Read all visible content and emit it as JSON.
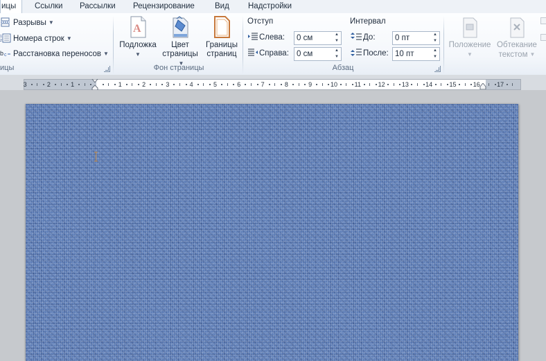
{
  "tabs": [
    {
      "label": "ицы",
      "active": true
    },
    {
      "label": "Ссылки"
    },
    {
      "label": "Рассылки"
    },
    {
      "label": "Рецензирование"
    },
    {
      "label": "Вид"
    },
    {
      "label": "Надстройки"
    }
  ],
  "page_setup": {
    "breaks_label": "Разрывы",
    "line_numbers_label": "Номера строк",
    "hyphenation_label": "Расстановка переносов",
    "group_label": "ицы"
  },
  "page_background": {
    "watermark_label_1": "Подложка",
    "page_color_label_1": "Цвет",
    "page_color_label_2": "страницы",
    "page_borders_label_1": "Границы",
    "page_borders_label_2": "страниц",
    "group_label": "Фон страницы"
  },
  "paragraph": {
    "indent_title": "Отступ",
    "indent_left_label": "Слева:",
    "indent_left_value": "0 см",
    "indent_right_label": "Справа:",
    "indent_right_value": "0 см",
    "spacing_title": "Интервал",
    "spacing_before_label": "До:",
    "spacing_before_value": "0 пт",
    "spacing_after_label": "После:",
    "spacing_after_value": "10 пт",
    "group_label": "Абзац"
  },
  "arrange": {
    "position_label": "Положение",
    "wrap_text_label_1": "Обтекание",
    "wrap_text_label_2": "текстом"
  },
  "ruler": {
    "labels": [
      "3",
      "2",
      "1",
      "1",
      "2",
      "3",
      "4",
      "5",
      "6",
      "7",
      "8",
      "9",
      "10",
      "11",
      "12",
      "13",
      "14",
      "15",
      "16",
      "17"
    ]
  },
  "colors": {
    "page_texture": "#5f7fb8",
    "ribbon_border": "#b9c7d8",
    "workspace": "#c6c9cd"
  }
}
